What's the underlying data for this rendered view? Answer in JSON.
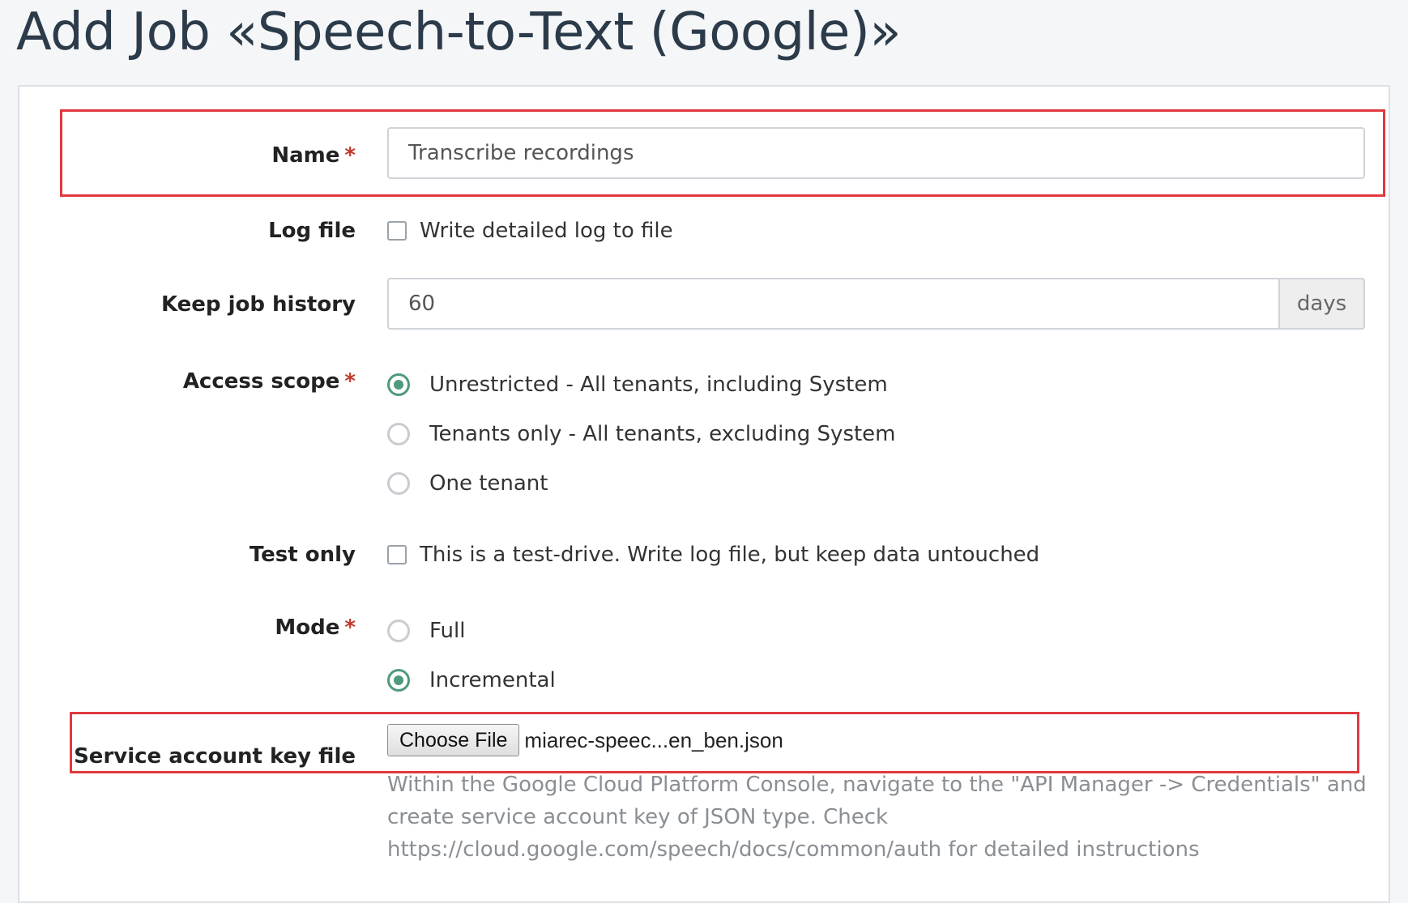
{
  "title": "Add Job «Speech-to-Text (Google)»",
  "colors": {
    "accent_radio": "#4e9a7b",
    "required": "#c0392b",
    "highlight": "#e0393e",
    "title": "#2c3b4a"
  },
  "fields": {
    "name": {
      "label": "Name",
      "required_mark": "*",
      "value": "Transcribe recordings"
    },
    "log_file": {
      "label": "Log file",
      "checkbox_label": "Write detailed log to file",
      "checked": false
    },
    "keep_history": {
      "label": "Keep job history",
      "value": "60",
      "unit": "days"
    },
    "access_scope": {
      "label": "Access scope",
      "required_mark": "*",
      "options": [
        {
          "label": "Unrestricted - All tenants, including System",
          "selected": true
        },
        {
          "label": "Tenants only - All tenants, excluding System",
          "selected": false
        },
        {
          "label": "One tenant",
          "selected": false
        }
      ]
    },
    "test_only": {
      "label": "Test only",
      "checkbox_label": "This is a test-drive. Write log file, but keep data untouched",
      "checked": false
    },
    "mode": {
      "label": "Mode",
      "required_mark": "*",
      "options": [
        {
          "label": "Full",
          "selected": false
        },
        {
          "label": "Incremental",
          "selected": true
        }
      ]
    },
    "key_file": {
      "label": "Service account key file",
      "button_label": "Choose File",
      "file_name": "miarec-speec...en_ben.json",
      "help_text": "Within the Google Cloud Platform Console, navigate to the \"API Manager -> Credentials\" and create service account key of JSON type. Check https://cloud.google.com/speech/docs/common/auth for detailed instructions"
    }
  }
}
